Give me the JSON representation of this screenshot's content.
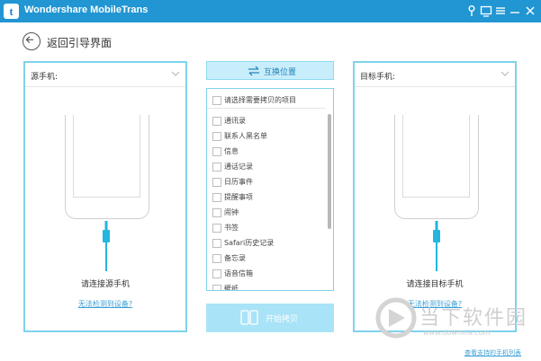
{
  "app": {
    "title": "Wondershare MobileTrans",
    "logo_letter": "t"
  },
  "titlebar_icons": [
    "pin-icon",
    "chat-icon",
    "menu-icon",
    "minimize-icon",
    "close-icon"
  ],
  "back": {
    "title": "返回引导界面"
  },
  "source_panel": {
    "label": "源手机:",
    "status": "请连接源手机",
    "link": "无法检测到设备?"
  },
  "target_panel": {
    "label": "目标手机:",
    "status": "请连接目标手机",
    "link": "无法检测到设备?"
  },
  "swap_button": {
    "label": "互换位置"
  },
  "item_list": {
    "header": "请选择需要拷贝的项目",
    "items": [
      "通讯录",
      "联系人黑名单",
      "信息",
      "通话记录",
      "日历事件",
      "提醒事项",
      "闹钟",
      "书签",
      "Safari历史记录",
      "备忘录",
      "语音信箱",
      "壁纸"
    ]
  },
  "start_button": {
    "label": "开始拷贝"
  },
  "watermark": {
    "text": "当下软件园",
    "url": "www.downxia.com"
  },
  "bottom_link": "查看支持的手机列表",
  "colors": {
    "titlebar": "#2196d3",
    "panel_border": "#7fd2ec",
    "cable": "#23b6e0",
    "link": "#3a9fd8"
  }
}
